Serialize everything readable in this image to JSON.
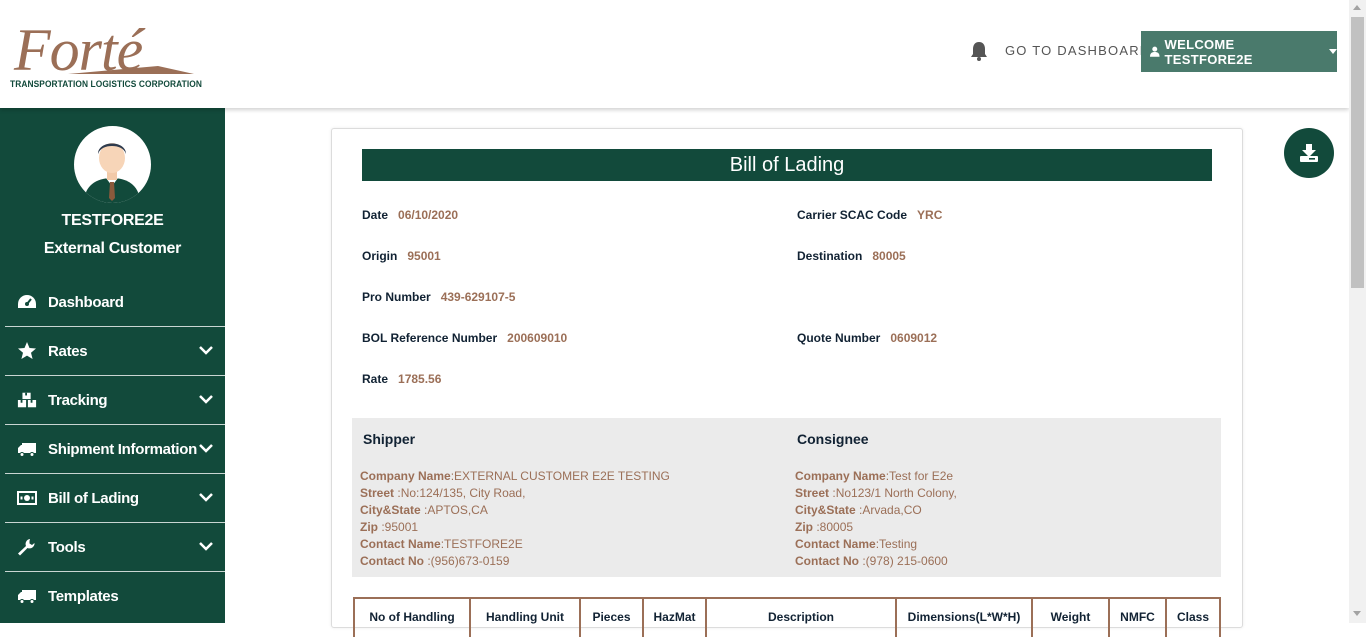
{
  "header": {
    "logo_word": "Forté",
    "logo_subtitle": "TRANSPORTATION LOGISTICS CORPORATION",
    "goto_dashboard": "GO TO DASHBOARD",
    "welcome": "WELCOME TESTFORE2E"
  },
  "user": {
    "name": "TESTFORE2E",
    "role": "External Customer"
  },
  "sidebar": {
    "items": [
      {
        "label": "Dashboard",
        "icon": "dashboard-gauge-icon",
        "expandable": false
      },
      {
        "label": "Rates",
        "icon": "star-icon",
        "expandable": true
      },
      {
        "label": "Tracking",
        "icon": "boxes-icon",
        "expandable": true
      },
      {
        "label": "Shipment Information",
        "icon": "truck-icon",
        "expandable": true
      },
      {
        "label": "Bill of Lading",
        "icon": "money-bill-icon",
        "expandable": true
      },
      {
        "label": "Tools",
        "icon": "wrench-icon",
        "expandable": true
      },
      {
        "label": "Templates",
        "icon": "truck-icon",
        "expandable": false
      }
    ]
  },
  "bol": {
    "title": "Bill of Lading",
    "date_label": "Date",
    "date": "06/10/2020",
    "scac_label": "Carrier SCAC Code",
    "scac": "YRC",
    "origin_label": "Origin",
    "origin": "95001",
    "destination_label": "Destination",
    "destination": "80005",
    "pro_label": "Pro Number",
    "pro": "439-629107-5",
    "bolref_label": "BOL Reference Number",
    "bolref": "200609010",
    "quote_label": "Quote Number",
    "quote": "0609012",
    "rate_label": "Rate",
    "rate": "1785.56"
  },
  "shipper": {
    "title": "Shipper",
    "company_label": "Company Name",
    "company": "EXTERNAL CUSTOMER E2E TESTING",
    "street_label": "Street",
    "street": "No:124/135, City Road,",
    "citystate_label": "City&State",
    "citystate": "APTOS,CA",
    "zip_label": "Zip",
    "zip": "95001",
    "contact_name_label": "Contact Name",
    "contact_name": "TESTFORE2E",
    "contact_no_label": "Contact No",
    "contact_no": "(956)673-0159"
  },
  "consignee": {
    "title": "Consignee",
    "company_label": "Company Name",
    "company": "Test for E2e",
    "street_label": "Street",
    "street": "No123/1 North Colony,",
    "citystate_label": "City&State",
    "citystate": "Arvada,CO",
    "zip_label": "Zip",
    "zip": "80005",
    "contact_name_label": "Contact Name",
    "contact_name": "Testing",
    "contact_no_label": "Contact No",
    "contact_no": "(978) 215-0600"
  },
  "table": {
    "headers": [
      "No of Handling",
      "Handling Unit",
      "Pieces",
      "HazMat",
      "Description",
      "Dimensions(L*W*H)",
      "Weight",
      "NMFC",
      "Class"
    ]
  },
  "colors": {
    "brand_green": "#124a3b",
    "brand_brown": "#9b6f57",
    "welcome_bg": "#4a7a6c"
  }
}
